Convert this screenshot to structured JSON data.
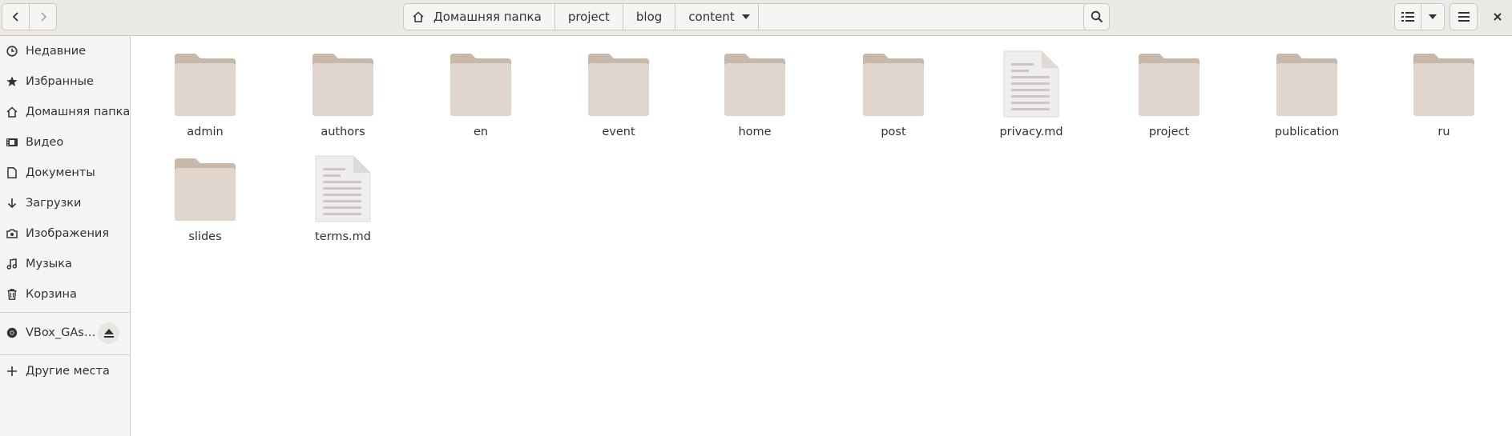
{
  "header": {
    "breadcrumbs": [
      {
        "label": "Домашняя папка"
      },
      {
        "label": "project"
      },
      {
        "label": "blog"
      },
      {
        "label": "content"
      }
    ]
  },
  "sidebar": {
    "items": [
      {
        "label": "Недавние",
        "icon": "clock-icon"
      },
      {
        "label": "Избранные",
        "icon": "star-icon"
      },
      {
        "label": "Домашняя папка",
        "icon": "home-icon"
      },
      {
        "label": "Видео",
        "icon": "video-icon"
      },
      {
        "label": "Документы",
        "icon": "document-icon"
      },
      {
        "label": "Загрузки",
        "icon": "download-icon"
      },
      {
        "label": "Изображения",
        "icon": "camera-icon"
      },
      {
        "label": "Музыка",
        "icon": "music-icon"
      },
      {
        "label": "Корзина",
        "icon": "trash-icon"
      }
    ],
    "device": {
      "label": "VBox_GAs…",
      "icon": "disc-icon"
    },
    "other": {
      "label": "Другие места",
      "icon": "plus-icon"
    }
  },
  "files": [
    {
      "name": "admin",
      "type": "folder"
    },
    {
      "name": "authors",
      "type": "folder"
    },
    {
      "name": "en",
      "type": "folder"
    },
    {
      "name": "event",
      "type": "folder"
    },
    {
      "name": "home",
      "type": "folder"
    },
    {
      "name": "post",
      "type": "folder"
    },
    {
      "name": "privacy.md",
      "type": "text-file"
    },
    {
      "name": "project",
      "type": "folder"
    },
    {
      "name": "publication",
      "type": "folder"
    },
    {
      "name": "ru",
      "type": "folder"
    },
    {
      "name": "slides",
      "type": "folder"
    },
    {
      "name": "terms.md",
      "type": "text-file"
    }
  ],
  "colors": {
    "folder_back": "#c7b8aa",
    "folder_front": "#e0d6cd",
    "file_page": "#f0eeec",
    "file_lines": "#c9c6c3"
  }
}
